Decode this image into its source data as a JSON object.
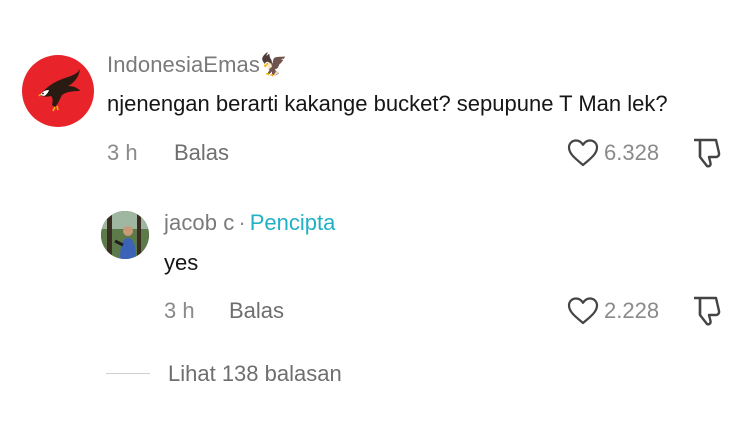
{
  "comment": {
    "username": "IndonesiaEmas",
    "emoji": "🦅",
    "text": "njenengan berarti kakange bucket? sepupune T Man lek?",
    "time": "3 h",
    "reply_label": "Balas",
    "like_count": "6.328",
    "avatar_icon": "eagle-icon",
    "avatar_color": "#e8232a"
  },
  "reply": {
    "username": "jacob c",
    "separator": "·",
    "creator_label": "Pencipta",
    "text": "yes",
    "time": "3 h",
    "reply_label": "Balas",
    "like_count": "2.228",
    "avatar_icon": "person-photo"
  },
  "view_replies_label": "Lihat 138 balasan",
  "colors": {
    "accent": "#20b1c4",
    "text_primary": "#161616",
    "text_secondary": "#8a8a8a"
  }
}
